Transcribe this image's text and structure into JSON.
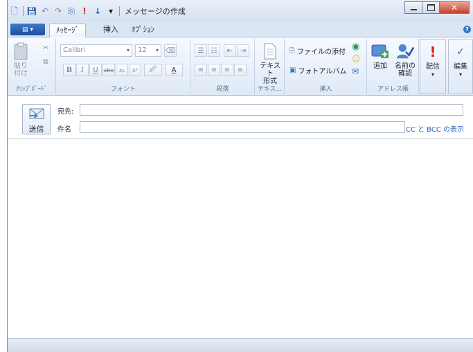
{
  "window": {
    "title": "メッセージの作成",
    "qat_menu_glyph": "▾"
  },
  "tabs": {
    "app_menu": "▤ ▾",
    "items": [
      {
        "label": "ﾒｯｾｰｼﾞ",
        "active": true
      },
      {
        "label": "挿入",
        "active": false
      },
      {
        "label": "ｵﾌﾟｼｮﾝ",
        "active": false
      }
    ],
    "help": "?"
  },
  "ribbon": {
    "clipboard": {
      "label": "ｸﾘｯﾌﾟﾎﾞｰﾄﾞ",
      "paste_line1": "貼り",
      "paste_line2": "付け"
    },
    "font": {
      "label": "フォント",
      "font_name": "Calibri",
      "font_size": "12",
      "bold": "B",
      "italic": "I",
      "underline": "U",
      "strike": "abe",
      "subscript": "x₂",
      "superscript": "x²",
      "highlight": "🖉",
      "fontcolor": "A"
    },
    "paragraph": {
      "label": "段落"
    },
    "text_format": {
      "label": "テキス...",
      "btn_line1": "テキスト",
      "btn_line2": "形式"
    },
    "insert": {
      "label": "挿入",
      "attach": "ファイルの添付",
      "photo_album": "フォトアルバム"
    },
    "address": {
      "label": "アドレス帳",
      "add": "追加",
      "check_line1": "名前の",
      "check_line2": "確認"
    },
    "deliver": {
      "label": "配信"
    },
    "edit": {
      "label": "編集"
    }
  },
  "compose": {
    "send_label": "送信",
    "to_label": "宛先:",
    "to_value": "",
    "subject_label": "件名",
    "subject_value": "",
    "cc_bcc_link": "CC と BCC の表示"
  },
  "colors": {
    "accent": "#2a62b8",
    "titlebar": "#d5e2f2",
    "ribbon": "#dfe9f6",
    "close": "#c3412b"
  }
}
